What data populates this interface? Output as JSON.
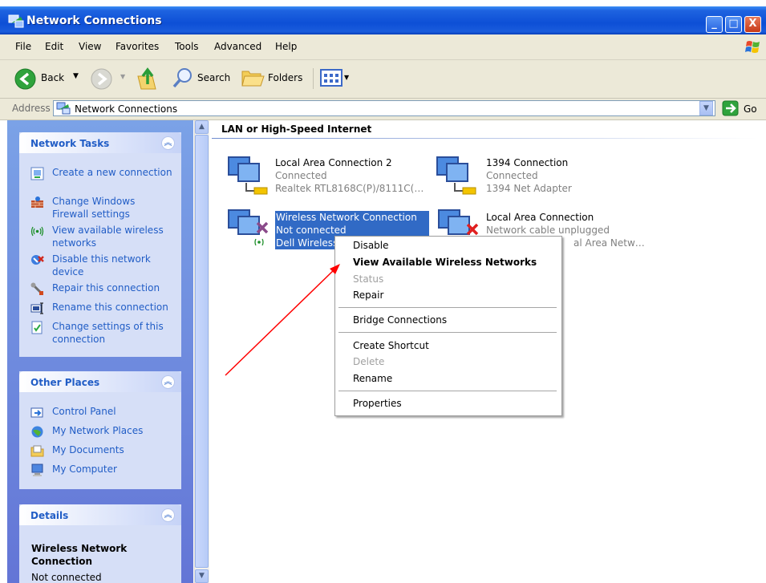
{
  "window": {
    "title": "Network Connections",
    "buttons": [
      "_",
      "□",
      "X"
    ]
  },
  "menu": [
    "File",
    "Edit",
    "View",
    "Favorites",
    "Tools",
    "Advanced",
    "Help"
  ],
  "toolbar": {
    "back": "Back",
    "search": "Search",
    "folders": "Folders"
  },
  "address": {
    "label": "Address",
    "value": "Network Connections",
    "go": "Go"
  },
  "network_tasks": {
    "title": "Network Tasks",
    "items": [
      {
        "label": "Create a new connection",
        "icon": "new-connection-icon"
      },
      {
        "label": "Change Windows Firewall settings",
        "icon": "firewall-icon"
      },
      {
        "label": "View available wireless networks",
        "icon": "wireless-icon"
      },
      {
        "label": "Disable this network device",
        "icon": "disable-device-icon"
      },
      {
        "label": "Repair this connection",
        "icon": "repair-icon"
      },
      {
        "label": "Rename this connection",
        "icon": "rename-icon"
      },
      {
        "label": "Change settings of this connection",
        "icon": "settings-icon"
      }
    ]
  },
  "other_places": {
    "title": "Other Places",
    "items": [
      {
        "label": "Control Panel",
        "icon": "control-panel-icon"
      },
      {
        "label": "My Network Places",
        "icon": "network-places-icon"
      },
      {
        "label": "My Documents",
        "icon": "documents-icon"
      },
      {
        "label": "My Computer",
        "icon": "computer-icon"
      }
    ]
  },
  "details": {
    "title": "Details",
    "name": "Wireless Network Connection",
    "status": "Not connected"
  },
  "content": {
    "group": "LAN or High-Speed Internet",
    "connections": [
      {
        "name": "Local Area Connection 2",
        "status": "Connected",
        "device": "Realtek RTL8168C(P)/8111C(…"
      },
      {
        "name": "1394 Connection",
        "status": "Connected",
        "device": "1394 Net Adapter"
      },
      {
        "name": "Wireless Network Connection",
        "status": "Not connected",
        "device": "Dell Wireless"
      },
      {
        "name": "Local Area Connection",
        "status": "Network cable unplugged",
        "device": "al Area Netw…"
      }
    ]
  },
  "context_menu": {
    "items": [
      "Disable",
      "View Available Wireless Networks",
      "Status",
      "Repair",
      "Bridge Connections",
      "Create Shortcut",
      "Delete",
      "Rename",
      "Properties"
    ]
  },
  "colors": {
    "title_bar": "#0d4fd6",
    "task_link": "#215dc6",
    "selection": "#316ac5",
    "annotation_arrow": "#ff0000"
  }
}
